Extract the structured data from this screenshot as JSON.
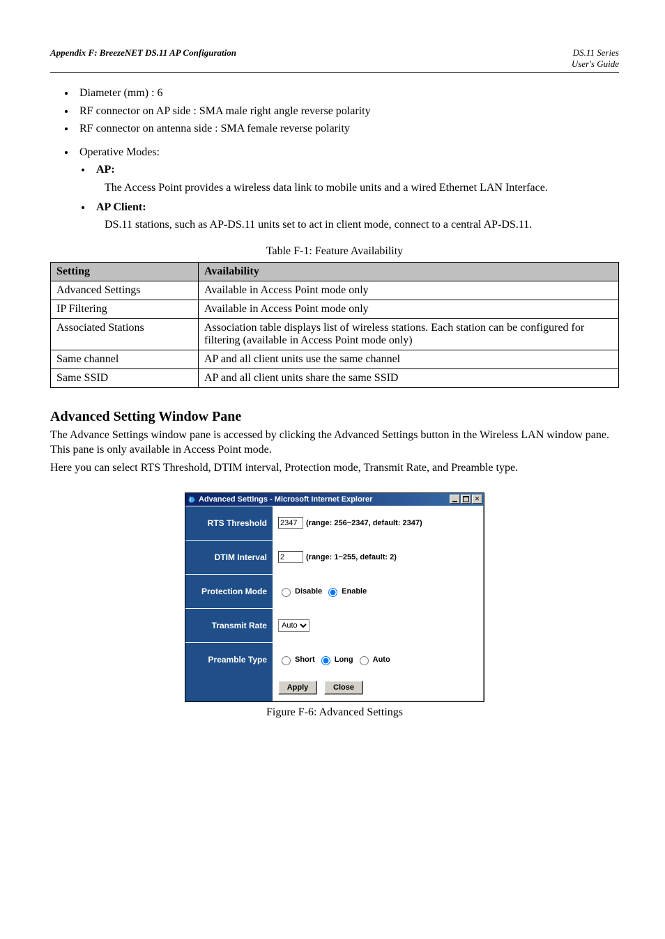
{
  "header": {
    "left": "Appendix F: BreezeNET DS.11 AP Configuration",
    "right_line1": "DS.11 Series",
    "right_line2": "User's Guide"
  },
  "specs": [
    {
      "label": "Diameter (mm)",
      "text": ": 6"
    },
    {
      "label": "RF connector on AP side",
      "text": ": SMA male right angle reverse polarity"
    },
    {
      "label": "RF connector on antenna side",
      "text": ": SMA female reverse polarity"
    }
  ],
  "operative_modes_label": "Operative Modes:",
  "modes": [
    {
      "label": "AP:",
      "text": "The Access Point provides a wireless data link to mobile units and a wired Ethernet LAN Interface."
    },
    {
      "label": "AP Client:",
      "text": "DS.11 stations, such as AP-DS.11 units set to act in client mode, connect to a central AP-DS.11."
    }
  ],
  "table_title": "Table F-1: Feature Availability",
  "table": {
    "headers": [
      "Setting",
      "Availability"
    ],
    "rows": [
      [
        "Advanced Settings",
        "Available in Access Point mode only"
      ],
      [
        "IP Filtering",
        "Available in Access Point mode only"
      ],
      [
        "Associated Stations",
        "Association table displays list of wireless stations. Each station can be configured for filtering (available in Access Point mode only)"
      ],
      [
        "Same channel",
        "AP and all client units use the same channel"
      ],
      [
        "Same SSID",
        "AP and all client units share the same SSID"
      ]
    ]
  },
  "section": {
    "heading": "Advanced Setting Window Pane",
    "paras": [
      "The Advance Settings window pane is accessed by clicking the Advanced Settings button in the Wireless LAN window pane. This pane is only available in Access Point mode.",
      "Here you can select RTS Threshold, DTIM interval, Protection mode, Transmit Rate, and Preamble type."
    ]
  },
  "screenshot": {
    "window_title": "Advanced Settings - Microsoft Internet Explorer",
    "rows": {
      "rts": {
        "label": "RTS Threshold",
        "value": "2347",
        "hint": "(range: 256~2347, default: 2347)"
      },
      "dtim": {
        "label": "DTIM Interval",
        "value": "2",
        "hint": "(range: 1~255, default: 2)"
      },
      "protection": {
        "label": "Protection Mode",
        "options": {
          "disable": "Disable",
          "enable": "Enable"
        },
        "selected": "enable"
      },
      "txrate": {
        "label": "Transmit Rate",
        "value": "Auto"
      },
      "preamble": {
        "label": "Preamble Type",
        "options": {
          "short": "Short",
          "long": "Long",
          "auto": "Auto"
        },
        "selected": "long"
      }
    },
    "buttons": {
      "apply": "Apply",
      "close": "Close"
    }
  },
  "figure_caption": "Figure F-6: Advanced Settings"
}
